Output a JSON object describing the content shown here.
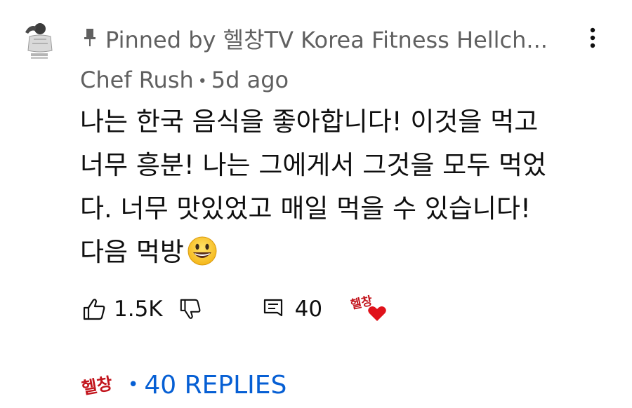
{
  "comment": {
    "pinned_label": "Pinned by 헬창TV Korea Fitness Hellch...",
    "author": "Chef Rush",
    "separator": "•",
    "time_ago": "5d ago",
    "text": "나는 한국 음식을 좋아합니다! 이것을 먹고\n너무 흥분! 나는 그에게서 그것을 모두 먹었\n다. 너무 맛있었고 매일 먹을 수 있습니다!\n다음 먹방",
    "emoji": "grinning-face"
  },
  "actions": {
    "like_count": "1.5K",
    "reply_count": "40",
    "creator_heart_text": "헬창"
  },
  "replies": {
    "separator": "•",
    "label": "40 REPLIES",
    "creator_text": "헬창"
  },
  "colors": {
    "secondary_text": "#606060",
    "primary_text": "#0f0f0f",
    "link_blue": "#065fd4",
    "heart_red": "#e0121b",
    "creator_red": "#c2141c"
  }
}
